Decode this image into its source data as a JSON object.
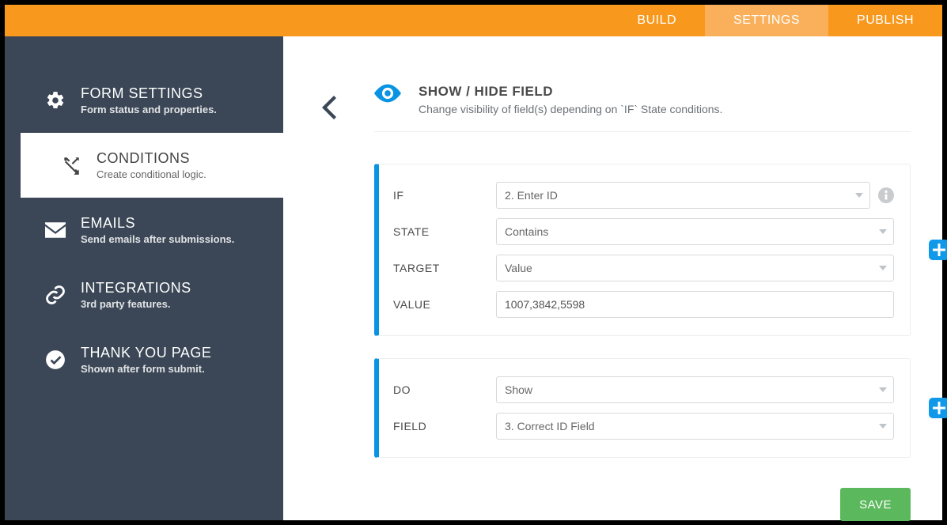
{
  "tabs": {
    "build": "BUILD",
    "settings": "SETTINGS",
    "publish": "PUBLISH"
  },
  "sidebar": {
    "items": [
      {
        "title": "FORM SETTINGS",
        "sub": "Form status and properties."
      },
      {
        "title": "CONDITIONS",
        "sub": "Create conditional logic."
      },
      {
        "title": "EMAILS",
        "sub": "Send emails after submissions."
      },
      {
        "title": "INTEGRATIONS",
        "sub": "3rd party features."
      },
      {
        "title": "THANK YOU PAGE",
        "sub": "Shown after form submit."
      }
    ]
  },
  "header": {
    "title": "SHOW / HIDE FIELD",
    "sub": "Change visibility of field(s) depending on `IF` State conditions."
  },
  "ifBlock": {
    "labels": {
      "if": "IF",
      "state": "STATE",
      "target": "TARGET",
      "value": "VALUE"
    },
    "fields": {
      "if": "2. Enter ID",
      "state": "Contains",
      "target": "Value",
      "value": "1007,3842,5598"
    }
  },
  "doBlock": {
    "labels": {
      "do": "DO",
      "field": "FIELD"
    },
    "fields": {
      "do": "Show",
      "field": "3. Correct ID Field"
    }
  },
  "buttons": {
    "save": "SAVE"
  }
}
